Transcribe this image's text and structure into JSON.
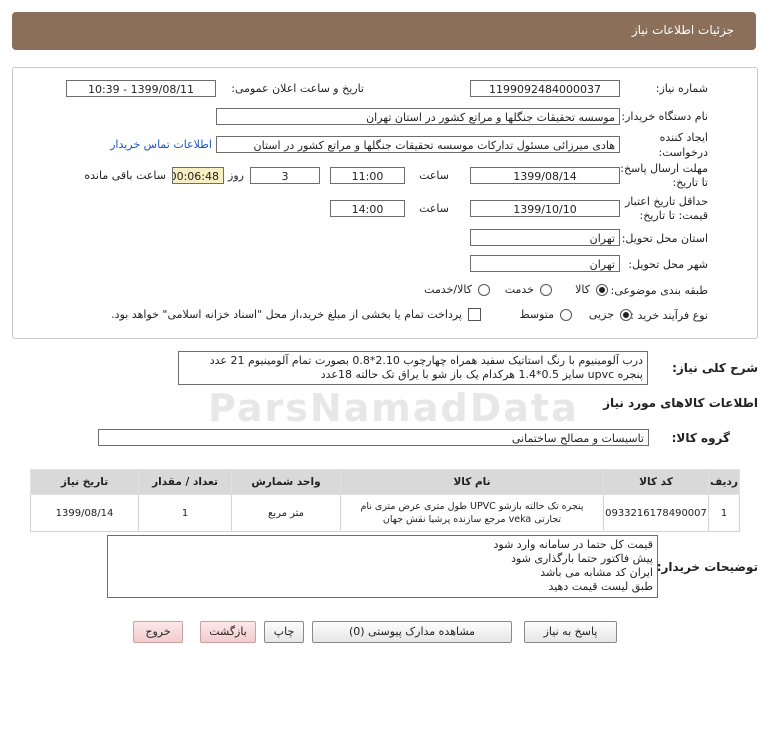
{
  "header": {
    "title": "جزئیات اطلاعات نیاز"
  },
  "fields": {
    "need_number_label": "شماره نیاز:",
    "need_number": "1199092484000037",
    "announce_label": "تاریخ و ساعت اعلان عمومی:",
    "announce_value": "1399/08/11 - 10:39",
    "buyer_org_label": "نام دستگاه خریدار:",
    "buyer_org": "موسسه تحقیقات جنگلها و مراتع کشور در استان تهران",
    "creator_label": "ایجاد کننده درخواست:",
    "creator": "هادی میرزائی مسئول تدارکات موسسه تحقیقات جنگلها و مراتع کشور در استان",
    "contact_link": "اطلاعات تماس خریدار",
    "deadline_label": "مهلت ارسال پاسخ: تا تاریخ:",
    "deadline_date": "1399/08/14",
    "time_label": "ساعت",
    "deadline_time": "11:00",
    "days_value": "3",
    "days_label": "روز و",
    "remaining_value": "00:06:48",
    "remaining_label": "ساعت باقی مانده",
    "validity_label": "حداقل تاریخ اعتبار قیمت: تا تاریخ:",
    "validity_date": "1399/10/10",
    "validity_time": "14:00",
    "province_label": "استان محل تحویل:",
    "province": "تهران",
    "city_label": "شهر محل تحویل:",
    "city": "تهران",
    "category_label": "طبقه بندی موضوعی:",
    "category_options": [
      "کالا",
      "خدمت",
      "کالا/خدمت"
    ],
    "process_label": "نوع فرآیند خرید :",
    "process_options": [
      "جزیی",
      "متوسط"
    ],
    "payment_note": "پرداخت تمام یا بخشی از مبلغ خرید،از محل \"اسناد خزانه اسلامی\" خواهد بود."
  },
  "general_desc": {
    "label": "شرح کلی نیاز:",
    "line1": "درب آلومینیوم با رنگ استاتیک سفید همراه چهارچوب 2.10*0.8 بصورت تمام آلومینیوم 21 عدد",
    "line2": "پنجره upvc سایز 0.5*1.4 هرکدام یک باز شو با یراق تک حالته 18عدد"
  },
  "goods_info_title": "اطلاعات کالاهای مورد نیاز",
  "goods_group": {
    "label": "گروه کالا:",
    "value": "تاسیسات و مصالح ساختمانی"
  },
  "table": {
    "headers": [
      "ردیف",
      "کد کالا",
      "نام کالا",
      "واحد شمارش",
      "تعداد / مقدار",
      "تاریخ نیاز"
    ],
    "rows": [
      {
        "row": "1",
        "code": "0933216178490007",
        "name1": "پنجره تک حالته بازشو UPVC طول متری عرض متری نام",
        "name2": "تجارتی veka مرجع سازنده پرشیا نقش جهان",
        "unit": "متر مربع",
        "qty": "1",
        "date": "1399/08/14"
      }
    ]
  },
  "buyer_notes": {
    "label": "توضیحات خریدار:",
    "lines": [
      "قیمت کل حتما در سامانه وارد شود",
      "پیش فاکتور حتما بارگذاری شود",
      "ایران کد مشابه می باشد",
      "طبق لیست قیمت دهید"
    ]
  },
  "buttons": {
    "reply": "پاسخ به نیاز",
    "attachments": "مشاهده مدارک پیوستی (0)",
    "print": "چاپ",
    "back": "بازگشت",
    "exit": "خروج"
  },
  "watermark": "ParsNamadData"
}
